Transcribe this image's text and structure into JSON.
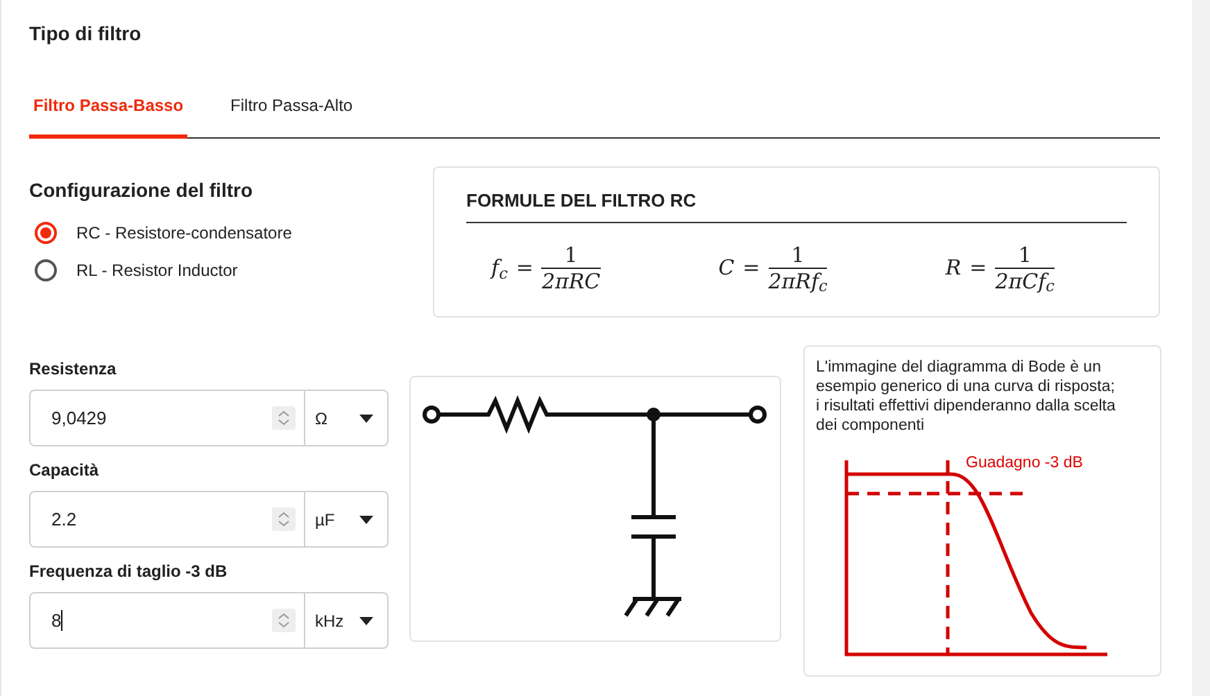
{
  "section_title": "Tipo di filtro",
  "tabs": [
    {
      "label": "Filtro Passa-Basso",
      "selected": true
    },
    {
      "label": "Filtro Passa-Alto",
      "selected": false
    }
  ],
  "configuration": {
    "title": "Configurazione del filtro",
    "options": [
      {
        "label": "RC - Resistore-condensatore",
        "selected": true
      },
      {
        "label": "RL - Resistor Inductor",
        "selected": false
      }
    ]
  },
  "formulas": {
    "title": "FORMULE DEL FILTRO RC",
    "items": [
      {
        "lhs": "f$_{c}$",
        "relation": "=",
        "numerator": "1",
        "denominator": "2πRC"
      },
      {
        "lhs": "C",
        "relation": "=",
        "numerator": "1",
        "denominator": "2πRf$_{c}$"
      },
      {
        "lhs": "R",
        "relation": "=",
        "numerator": "1",
        "denominator": "2πCf$_{c}$"
      }
    ]
  },
  "fields": [
    {
      "label": "Resistenza",
      "value": "9,0429",
      "unit": "Ω",
      "focused": false
    },
    {
      "label": "Capacità",
      "value": "2.2",
      "unit": "µF",
      "focused": false
    },
    {
      "label": "Frequenza di taglio -3 dB",
      "value": "8",
      "unit": "kHz",
      "focused": true
    }
  ],
  "bode": {
    "note": "L'immagine del diagramma di Bode è un esempio generico di una curva di risposta; i risultati effettivi dipenderanno dalla scelta dei componenti",
    "annotation": "Guadagno -3 dB"
  }
}
